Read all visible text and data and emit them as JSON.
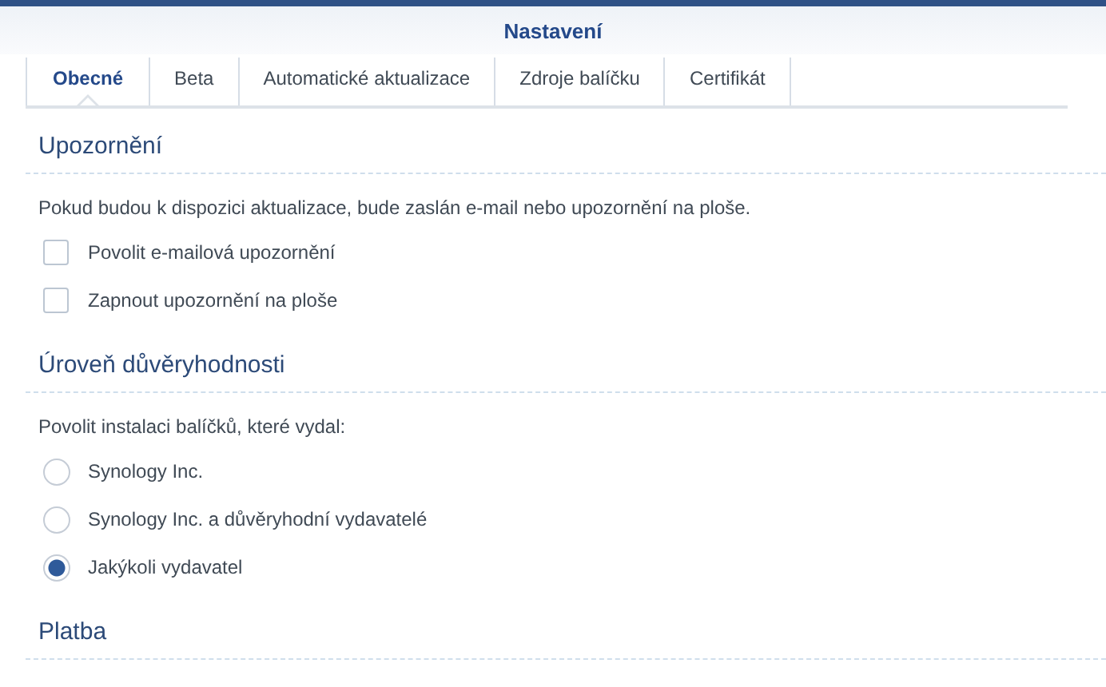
{
  "window": {
    "title": "Nastavení"
  },
  "tabs": [
    {
      "label": "Obecné",
      "selected": true
    },
    {
      "label": "Beta",
      "selected": false
    },
    {
      "label": "Automatické aktualizace",
      "selected": false
    },
    {
      "label": "Zdroje balíčku",
      "selected": false
    },
    {
      "label": "Certifikát",
      "selected": false
    }
  ],
  "sections": [
    {
      "heading": "Upozornění",
      "description": "Pokud budou k dispozici aktualizace, bude zaslán e-mail nebo upozornění na ploše.",
      "options": [
        {
          "kind": "checkbox",
          "label": "Povolit e-mailová upozornění",
          "checked": false
        },
        {
          "kind": "checkbox",
          "label": "Zapnout upozornění na ploše",
          "checked": false
        }
      ]
    },
    {
      "heading": "Úroveň důvěryhodnosti",
      "description": "Povolit instalaci balíčků, které vydal:",
      "options": [
        {
          "kind": "radio",
          "label": "Synology Inc.",
          "selected": false
        },
        {
          "kind": "radio",
          "label": "Synology Inc. a důvěryhodní vydavatelé",
          "selected": false
        },
        {
          "kind": "radio",
          "label": "Jakýkoli vydavatel",
          "selected": true
        }
      ]
    },
    {
      "heading": "Platba"
    }
  ]
}
